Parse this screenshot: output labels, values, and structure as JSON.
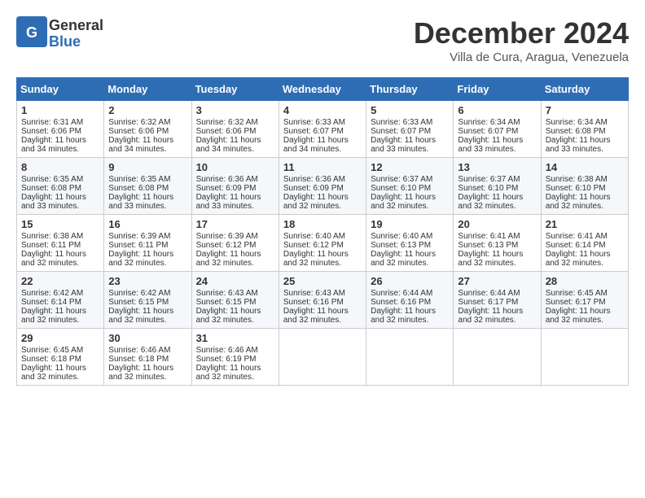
{
  "header": {
    "logo_general": "General",
    "logo_blue": "Blue",
    "title": "December 2024",
    "location": "Villa de Cura, Aragua, Venezuela"
  },
  "days_of_week": [
    "Sunday",
    "Monday",
    "Tuesday",
    "Wednesday",
    "Thursday",
    "Friday",
    "Saturday"
  ],
  "weeks": [
    [
      {
        "day": "1",
        "sunrise": "Sunrise: 6:31 AM",
        "sunset": "Sunset: 6:06 PM",
        "daylight": "Daylight: 11 hours and 34 minutes."
      },
      {
        "day": "2",
        "sunrise": "Sunrise: 6:32 AM",
        "sunset": "Sunset: 6:06 PM",
        "daylight": "Daylight: 11 hours and 34 minutes."
      },
      {
        "day": "3",
        "sunrise": "Sunrise: 6:32 AM",
        "sunset": "Sunset: 6:06 PM",
        "daylight": "Daylight: 11 hours and 34 minutes."
      },
      {
        "day": "4",
        "sunrise": "Sunrise: 6:33 AM",
        "sunset": "Sunset: 6:07 PM",
        "daylight": "Daylight: 11 hours and 34 minutes."
      },
      {
        "day": "5",
        "sunrise": "Sunrise: 6:33 AM",
        "sunset": "Sunset: 6:07 PM",
        "daylight": "Daylight: 11 hours and 33 minutes."
      },
      {
        "day": "6",
        "sunrise": "Sunrise: 6:34 AM",
        "sunset": "Sunset: 6:07 PM",
        "daylight": "Daylight: 11 hours and 33 minutes."
      },
      {
        "day": "7",
        "sunrise": "Sunrise: 6:34 AM",
        "sunset": "Sunset: 6:08 PM",
        "daylight": "Daylight: 11 hours and 33 minutes."
      }
    ],
    [
      {
        "day": "8",
        "sunrise": "Sunrise: 6:35 AM",
        "sunset": "Sunset: 6:08 PM",
        "daylight": "Daylight: 11 hours and 33 minutes."
      },
      {
        "day": "9",
        "sunrise": "Sunrise: 6:35 AM",
        "sunset": "Sunset: 6:08 PM",
        "daylight": "Daylight: 11 hours and 33 minutes."
      },
      {
        "day": "10",
        "sunrise": "Sunrise: 6:36 AM",
        "sunset": "Sunset: 6:09 PM",
        "daylight": "Daylight: 11 hours and 33 minutes."
      },
      {
        "day": "11",
        "sunrise": "Sunrise: 6:36 AM",
        "sunset": "Sunset: 6:09 PM",
        "daylight": "Daylight: 11 hours and 32 minutes."
      },
      {
        "day": "12",
        "sunrise": "Sunrise: 6:37 AM",
        "sunset": "Sunset: 6:10 PM",
        "daylight": "Daylight: 11 hours and 32 minutes."
      },
      {
        "day": "13",
        "sunrise": "Sunrise: 6:37 AM",
        "sunset": "Sunset: 6:10 PM",
        "daylight": "Daylight: 11 hours and 32 minutes."
      },
      {
        "day": "14",
        "sunrise": "Sunrise: 6:38 AM",
        "sunset": "Sunset: 6:10 PM",
        "daylight": "Daylight: 11 hours and 32 minutes."
      }
    ],
    [
      {
        "day": "15",
        "sunrise": "Sunrise: 6:38 AM",
        "sunset": "Sunset: 6:11 PM",
        "daylight": "Daylight: 11 hours and 32 minutes."
      },
      {
        "day": "16",
        "sunrise": "Sunrise: 6:39 AM",
        "sunset": "Sunset: 6:11 PM",
        "daylight": "Daylight: 11 hours and 32 minutes."
      },
      {
        "day": "17",
        "sunrise": "Sunrise: 6:39 AM",
        "sunset": "Sunset: 6:12 PM",
        "daylight": "Daylight: 11 hours and 32 minutes."
      },
      {
        "day": "18",
        "sunrise": "Sunrise: 6:40 AM",
        "sunset": "Sunset: 6:12 PM",
        "daylight": "Daylight: 11 hours and 32 minutes."
      },
      {
        "day": "19",
        "sunrise": "Sunrise: 6:40 AM",
        "sunset": "Sunset: 6:13 PM",
        "daylight": "Daylight: 11 hours and 32 minutes."
      },
      {
        "day": "20",
        "sunrise": "Sunrise: 6:41 AM",
        "sunset": "Sunset: 6:13 PM",
        "daylight": "Daylight: 11 hours and 32 minutes."
      },
      {
        "day": "21",
        "sunrise": "Sunrise: 6:41 AM",
        "sunset": "Sunset: 6:14 PM",
        "daylight": "Daylight: 11 hours and 32 minutes."
      }
    ],
    [
      {
        "day": "22",
        "sunrise": "Sunrise: 6:42 AM",
        "sunset": "Sunset: 6:14 PM",
        "daylight": "Daylight: 11 hours and 32 minutes."
      },
      {
        "day": "23",
        "sunrise": "Sunrise: 6:42 AM",
        "sunset": "Sunset: 6:15 PM",
        "daylight": "Daylight: 11 hours and 32 minutes."
      },
      {
        "day": "24",
        "sunrise": "Sunrise: 6:43 AM",
        "sunset": "Sunset: 6:15 PM",
        "daylight": "Daylight: 11 hours and 32 minutes."
      },
      {
        "day": "25",
        "sunrise": "Sunrise: 6:43 AM",
        "sunset": "Sunset: 6:16 PM",
        "daylight": "Daylight: 11 hours and 32 minutes."
      },
      {
        "day": "26",
        "sunrise": "Sunrise: 6:44 AM",
        "sunset": "Sunset: 6:16 PM",
        "daylight": "Daylight: 11 hours and 32 minutes."
      },
      {
        "day": "27",
        "sunrise": "Sunrise: 6:44 AM",
        "sunset": "Sunset: 6:17 PM",
        "daylight": "Daylight: 11 hours and 32 minutes."
      },
      {
        "day": "28",
        "sunrise": "Sunrise: 6:45 AM",
        "sunset": "Sunset: 6:17 PM",
        "daylight": "Daylight: 11 hours and 32 minutes."
      }
    ],
    [
      {
        "day": "29",
        "sunrise": "Sunrise: 6:45 AM",
        "sunset": "Sunset: 6:18 PM",
        "daylight": "Daylight: 11 hours and 32 minutes."
      },
      {
        "day": "30",
        "sunrise": "Sunrise: 6:46 AM",
        "sunset": "Sunset: 6:18 PM",
        "daylight": "Daylight: 11 hours and 32 minutes."
      },
      {
        "day": "31",
        "sunrise": "Sunrise: 6:46 AM",
        "sunset": "Sunset: 6:19 PM",
        "daylight": "Daylight: 11 hours and 32 minutes."
      },
      null,
      null,
      null,
      null
    ]
  ]
}
